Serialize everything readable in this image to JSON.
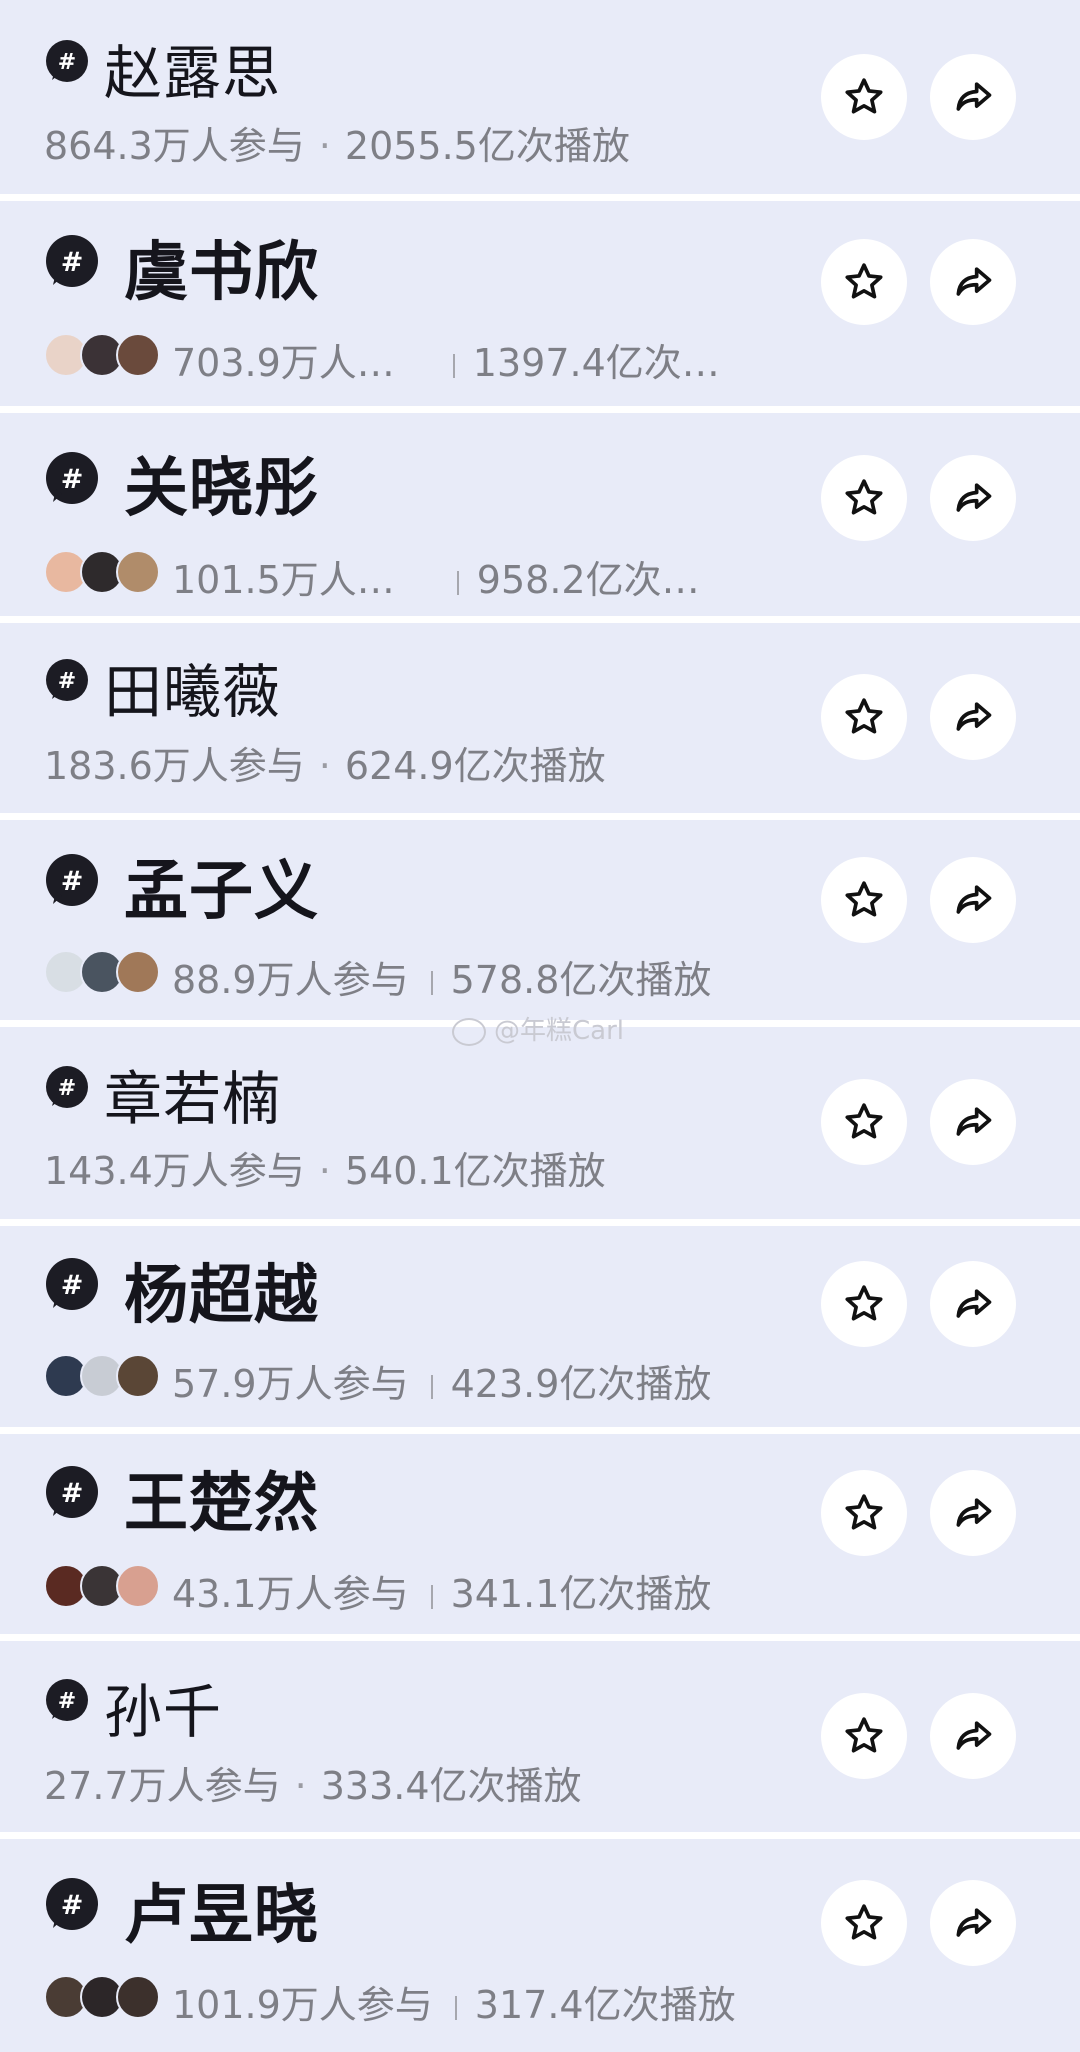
{
  "watermark": "@年糕Carl",
  "topics": [
    {
      "name": "赵露思",
      "style": "plain",
      "participants": "864.3万人参与",
      "plays": "2055.5亿次播放",
      "avatars": []
    },
    {
      "name": "虞书欣",
      "style": "avatars",
      "participants": "703.9万人…",
      "plays": "1397.4亿次…",
      "avatars": [
        "#e9d3c8",
        "#3b3236",
        "#6a4a3c"
      ]
    },
    {
      "name": "关晓彤",
      "style": "avatars",
      "participants": "101.5万人…",
      "plays": "958.2亿次…",
      "avatars": [
        "#e8b8a0",
        "#2e2a2c",
        "#b08c6a"
      ]
    },
    {
      "name": "田曦薇",
      "style": "plain",
      "participants": "183.6万人参与",
      "plays": "624.9亿次播放",
      "avatars": []
    },
    {
      "name": "孟子义",
      "style": "avatars",
      "participants": "88.9万人参与",
      "plays": "578.8亿次播放",
      "avatars": [
        "#d8dee4",
        "#4a5460",
        "#a07858"
      ]
    },
    {
      "name": "章若楠",
      "style": "plain",
      "participants": "143.4万人参与",
      "plays": "540.1亿次播放",
      "avatars": []
    },
    {
      "name": "杨超越",
      "style": "avatars",
      "participants": "57.9万人参与",
      "plays": "423.9亿次播放",
      "avatars": [
        "#2e3a50",
        "#c8ccd4",
        "#5a4636"
      ]
    },
    {
      "name": "王楚然",
      "style": "avatars",
      "participants": "43.1万人参与",
      "plays": "341.1亿次播放",
      "avatars": [
        "#5a2a22",
        "#3a3436",
        "#d8a090"
      ]
    },
    {
      "name": "孙千",
      "style": "plain",
      "participants": "27.7万人参与",
      "plays": "333.4亿次播放",
      "avatars": []
    },
    {
      "name": "卢昱晓",
      "style": "avatars",
      "participants": "101.9万人参与",
      "plays": "317.4亿次播放",
      "avatars": [
        "#4a3c34",
        "#2c2628",
        "#3c302c"
      ]
    }
  ]
}
